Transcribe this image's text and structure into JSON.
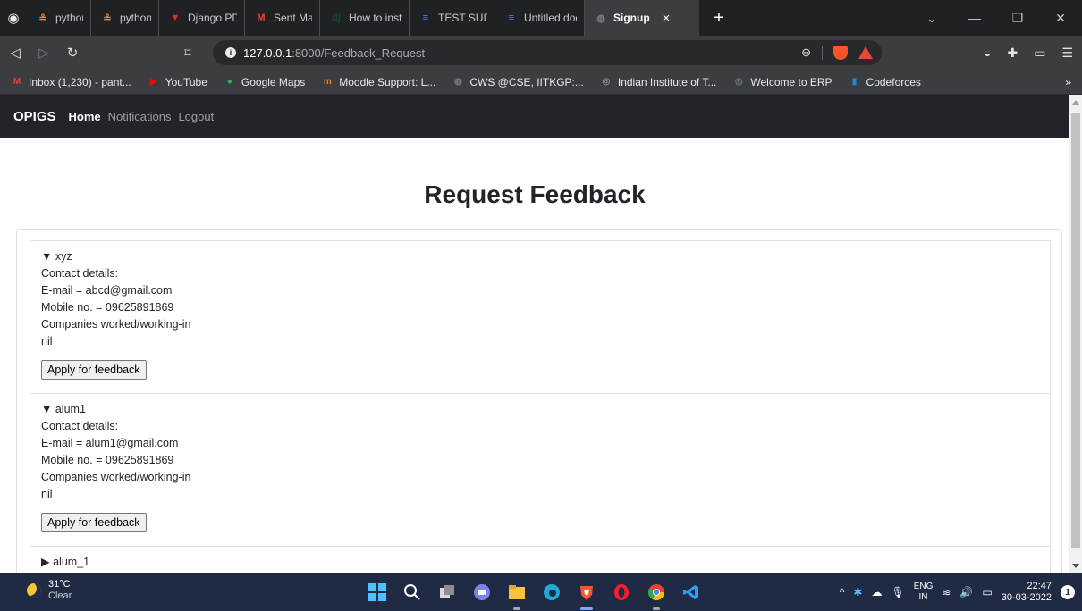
{
  "browser": {
    "tabs": [
      {
        "title": "python - Djan",
        "icon": "stackoverflow-icon",
        "active": false
      },
      {
        "title": "python - Djar",
        "icon": "stackoverflow-icon",
        "active": false
      },
      {
        "title": "Django PDF C",
        "icon": "vercel-icon",
        "active": false
      },
      {
        "title": "Sent Mail - p",
        "icon": "gmail-icon",
        "active": false
      },
      {
        "title": "How to instal",
        "icon": "django-icon",
        "active": false
      },
      {
        "title": "TEST SUITE -",
        "icon": "docs-icon",
        "active": false
      },
      {
        "title": "Untitled docu",
        "icon": "docs-icon",
        "active": false
      },
      {
        "title": "Signup",
        "icon": "globe-icon",
        "active": true,
        "close": "×"
      }
    ],
    "new_tab": "+",
    "window_controls": [
      "⌄",
      "—",
      "❐",
      "✕"
    ],
    "url": {
      "host": "127.0.0.1",
      "path": ":8000/Feedback_Request"
    },
    "bookmarks": [
      {
        "label": "Inbox (1,230) - pant...",
        "icon": "gmail-icon"
      },
      {
        "label": "YouTube",
        "icon": "youtube-icon"
      },
      {
        "label": "Google Maps",
        "icon": "maps-icon"
      },
      {
        "label": "Moodle Support: L...",
        "icon": "moodle-icon"
      },
      {
        "label": "CWS @CSE, IITKGP:...",
        "icon": "globe-icon"
      },
      {
        "label": "Indian Institute of T...",
        "icon": "iit-icon"
      },
      {
        "label": "Welcome to ERP",
        "icon": "erp-icon"
      },
      {
        "label": "Codeforces",
        "icon": "codeforces-icon"
      }
    ],
    "bookmarks_more": "»"
  },
  "navbar": {
    "brand": "OPIGS",
    "links": [
      "Home",
      "Notifications",
      "Logout"
    ]
  },
  "page": {
    "title": "Request Feedback",
    "items": [
      {
        "name": "xyz",
        "expanded": true,
        "contact_label": "Contact details:",
        "email": "E-mail = abcd@gmail.com",
        "mobile": "Mobile no. = 09625891869",
        "companies_label": "Companies worked/working-in",
        "companies": "nil",
        "button": "Apply for feedback"
      },
      {
        "name": "alum1",
        "expanded": true,
        "contact_label": "Contact details:",
        "email": "E-mail = alum1@gmail.com",
        "mobile": "Mobile no. = 09625891869",
        "companies_label": "Companies worked/working-in",
        "companies": "nil",
        "button": "Apply for feedback"
      },
      {
        "name": "alum_1",
        "expanded": false
      }
    ]
  },
  "taskbar": {
    "weather_temp": "31°C",
    "weather_desc": "Clear",
    "lang_line1": "ENG",
    "lang_line2": "IN",
    "time": "22:47",
    "date": "30-03-2022",
    "notification_count": "1"
  }
}
